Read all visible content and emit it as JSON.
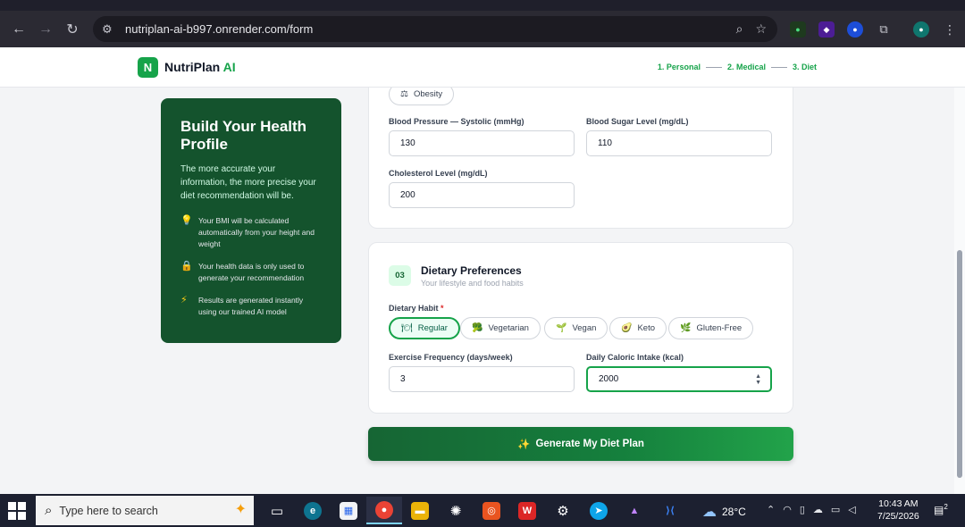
{
  "browser": {
    "url": "nutriplan-ai-b997.onrender.com/form"
  },
  "app": {
    "logo_letter": "N",
    "name": "NutriPlan",
    "name_accent": "AI",
    "steps": [
      "1. Personal",
      "2. Medical",
      "3. Diet"
    ]
  },
  "sidebar": {
    "title": "Build Your Health Profile",
    "description": "The more accurate your information, the more precise your diet recommendation will be.",
    "tips": [
      {
        "icon": "lightbulb-icon",
        "text": "Your BMI will be calculated automatically from your height and weight"
      },
      {
        "icon": "lock-icon",
        "text": "Your health data is only used to generate your recommendation"
      },
      {
        "icon": "lightning-icon",
        "text": "Results are generated instantly using our trained AI model"
      }
    ]
  },
  "medical": {
    "chip_obesity": "Obesity",
    "bp_label": "Blood Pressure — Systolic (mmHg)",
    "bp_value": "130",
    "sugar_label": "Blood Sugar Level (mg/dL)",
    "sugar_value": "110",
    "chol_label": "Cholesterol Level (mg/dL)",
    "chol_value": "200"
  },
  "prefs": {
    "badge": "03",
    "title": "Dietary Preferences",
    "subtitle": "Your lifestyle and food habits",
    "habit_label": "Dietary Habit",
    "required_mark": "*",
    "habits": [
      "Regular",
      "Vegetarian",
      "Vegan",
      "Keto",
      "Gluten-Free"
    ],
    "selected_habit": "Regular",
    "exercise_label": "Exercise Frequency (days/week)",
    "exercise_value": "3",
    "calorie_label": "Daily Caloric Intake (kcal)",
    "calorie_value": "2000"
  },
  "generate_button": "Generate My Diet Plan",
  "taskbar": {
    "search_placeholder": "Type here to search",
    "temperature": "28°C",
    "time": "10:43 AM",
    "date": "7/25/2026",
    "notifications": "2"
  }
}
